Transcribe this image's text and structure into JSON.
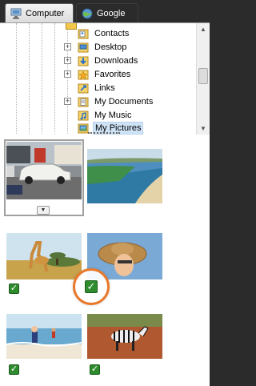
{
  "tabs": [
    {
      "label": "Computer",
      "icon": "computer-icon",
      "active": true
    },
    {
      "label": "Google",
      "icon": "globe-icon",
      "active": false
    }
  ],
  "tree": {
    "items": [
      {
        "label": "Contacts",
        "icon": "contacts-folder-icon",
        "expandable": false
      },
      {
        "label": "Desktop",
        "icon": "desktop-folder-icon",
        "expandable": true
      },
      {
        "label": "Downloads",
        "icon": "downloads-folder-icon",
        "expandable": true
      },
      {
        "label": "Favorites",
        "icon": "favorites-folder-icon",
        "expandable": true
      },
      {
        "label": "Links",
        "icon": "links-folder-icon",
        "expandable": false
      },
      {
        "label": "My Documents",
        "icon": "documents-folder-icon",
        "expandable": true
      },
      {
        "label": "My Music",
        "icon": "music-folder-icon",
        "expandable": false
      },
      {
        "label": "My Pictures",
        "icon": "pictures-folder-icon",
        "expandable": false,
        "selected": true
      }
    ]
  },
  "photos": [
    {
      "subject": "cars on street",
      "checked": false,
      "selected": true
    },
    {
      "subject": "coastline beach",
      "checked": false
    },
    {
      "subject": "giraffe in savanna",
      "checked": true
    },
    {
      "subject": "child with straw hat",
      "checked": true,
      "highlighted": true
    },
    {
      "subject": "child at beach",
      "checked": true
    },
    {
      "subject": "zebra",
      "checked": true
    }
  ],
  "colors": {
    "check_green": "#2e8b2e",
    "highlight_ring": "#e8792b",
    "tree_selection": "#cfe3f7"
  }
}
